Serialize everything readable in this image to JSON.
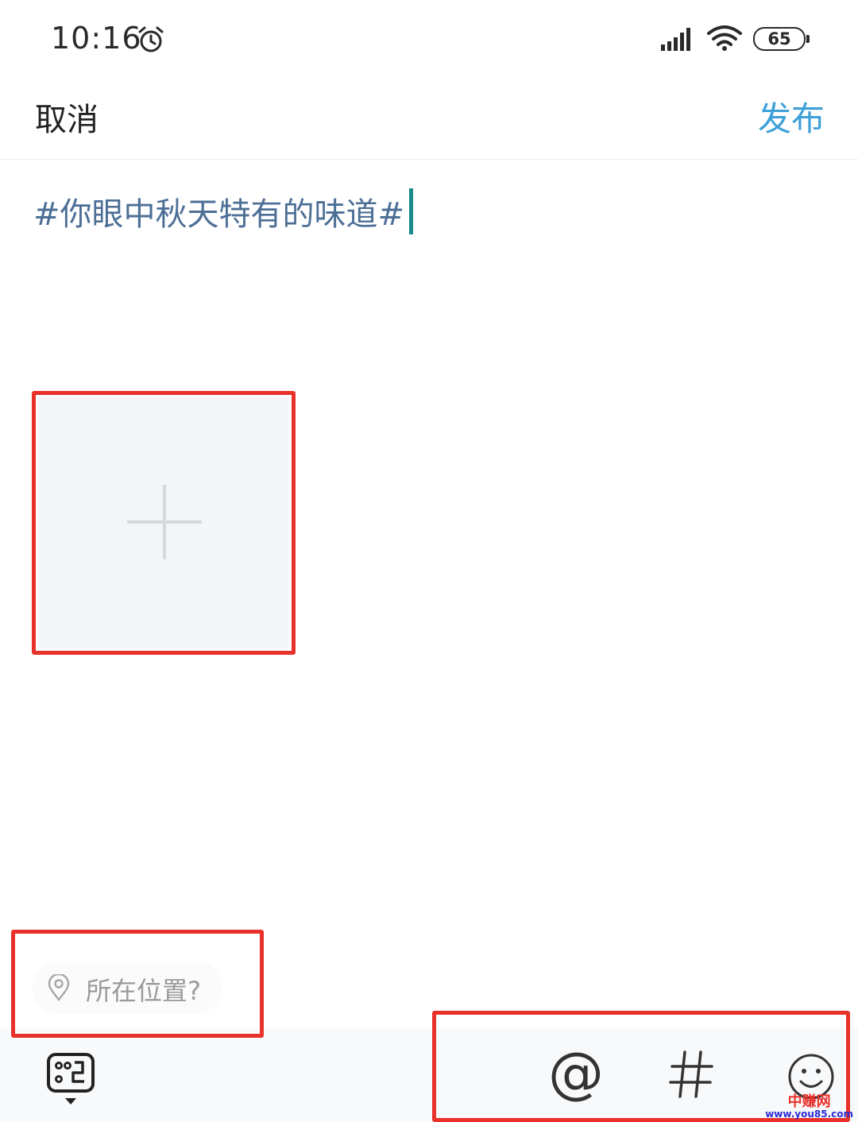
{
  "status_bar": {
    "time": "10:16",
    "battery": "65"
  },
  "header": {
    "cancel_label": "取消",
    "publish_label": "发布",
    "publish_color": "#3da0d8"
  },
  "compose": {
    "text": "#你眼中秋天特有的味道#"
  },
  "location": {
    "label": "所在位置?"
  },
  "toolbar": {
    "icons": [
      "keyboard-icon",
      "at-icon",
      "hash-icon",
      "emoji-icon"
    ],
    "at_symbol": "@"
  },
  "annotation_color": "#e8312a",
  "watermark": {
    "title": "中赚网",
    "url": "www.you85.com"
  }
}
